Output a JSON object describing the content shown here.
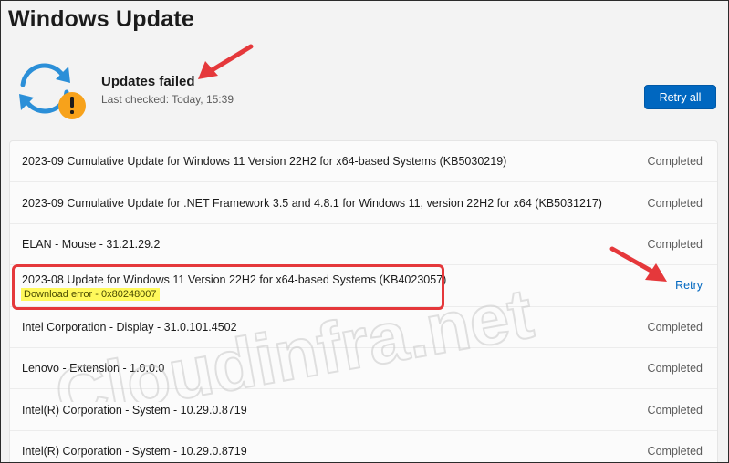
{
  "header": {
    "title": "Windows Update"
  },
  "status": {
    "title": "Updates failed",
    "last_checked": "Last checked: Today, 15:39",
    "icon": "sync-warning-icon"
  },
  "actions": {
    "retry_all_label": "Retry all"
  },
  "updates": [
    {
      "name": "2023-09 Cumulative Update for Windows 11 Version 22H2 for x64-based Systems (KB5030219)",
      "status": "Completed"
    },
    {
      "name": "2023-09 Cumulative Update for .NET Framework 3.5 and 4.8.1 for Windows 11, version 22H2 for x64 (KB5031217)",
      "status": "Completed"
    },
    {
      "name": "ELAN - Mouse - 31.21.29.2",
      "status": "Completed"
    },
    {
      "name": "2023-08 Update for Windows 11 Version 22H2 for x64-based Systems (KB4023057)",
      "error": "Download error - 0x80248007",
      "status": "Retry"
    },
    {
      "name": "Intel Corporation - Display - 31.0.101.4502",
      "status": "Completed"
    },
    {
      "name": "Lenovo - Extension - 1.0.0.0",
      "status": "Completed"
    },
    {
      "name": "Intel(R) Corporation - System - 10.29.0.8719",
      "status": "Completed"
    },
    {
      "name": "Intel(R) Corporation - System - 10.29.0.8719",
      "status": "Completed"
    }
  ],
  "watermark": "Cloudinfra.net",
  "colors": {
    "accent": "#0067c0",
    "annotation_red": "#e5383b",
    "highlight_yellow": "#fff95b",
    "warning_orange": "#f7a21b",
    "sync_blue": "#2b8fd8"
  }
}
